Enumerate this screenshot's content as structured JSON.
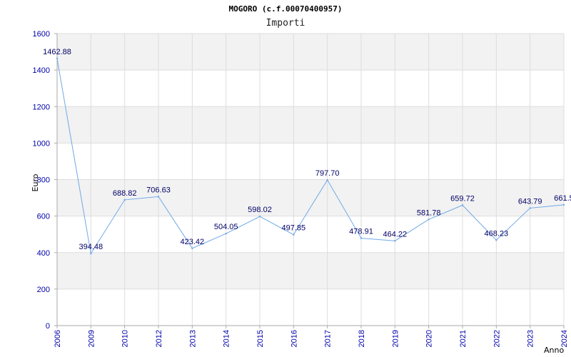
{
  "chart_data": {
    "type": "line",
    "title": "MOGORO (c.f.00070400957)",
    "subtitle": "Importi",
    "xlabel": "Anno",
    "ylabel": "Euro",
    "ylim": [
      0,
      1600
    ],
    "yticks": [
      0,
      200,
      400,
      600,
      800,
      1000,
      1200,
      1400,
      1600
    ],
    "grid": true,
    "categories": [
      "2006",
      "2009",
      "2010",
      "2012",
      "2013",
      "2014",
      "2015",
      "2016",
      "2017",
      "2018",
      "2019",
      "2020",
      "2021",
      "2022",
      "2023",
      "2024"
    ],
    "series": [
      {
        "values": [
          1462.88,
          394.48,
          688.82,
          706.63,
          423.42,
          504.05,
          598.02,
          497.85,
          797.7,
          478.91,
          464.22,
          581.78,
          659.72,
          468.23,
          643.79,
          661.5
        ],
        "labels": [
          "1462.88",
          "394.48",
          "688.82",
          "706.63",
          "423.42",
          "504.05",
          "598.02",
          "497.85",
          "797.70",
          "478.91",
          "464.22",
          "581.78",
          "659.72",
          "468.23",
          "643.79",
          "661.5"
        ],
        "color": "#6fa8e8"
      }
    ],
    "colors": {
      "band": "#f2f2f2",
      "gridline": "#dddddd",
      "axis": "#aaaaaa",
      "tick_text": "#0000aa",
      "label_text": "#000066"
    }
  }
}
